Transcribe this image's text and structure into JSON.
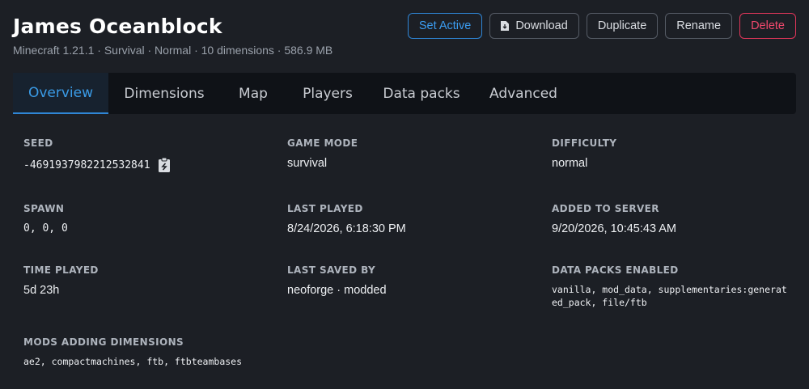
{
  "world": {
    "title": "James Oceanblock",
    "subtitle": "Minecraft 1.21.1 · Survival · Normal · 10 dimensions · 586.9 MB"
  },
  "actions": {
    "set_active": "Set Active",
    "download": "Download",
    "duplicate": "Duplicate",
    "rename": "Rename",
    "delete": "Delete"
  },
  "tabs": [
    "Overview",
    "Dimensions",
    "Map",
    "Players",
    "Data packs",
    "Advanced"
  ],
  "active_tab": "Overview",
  "overview": {
    "seed": {
      "label": "SEED",
      "value": "-4691937982212532841"
    },
    "game_mode": {
      "label": "GAME MODE",
      "value": "survival"
    },
    "difficulty": {
      "label": "DIFFICULTY",
      "value": "normal"
    },
    "spawn": {
      "label": "SPAWN",
      "value": "0, 0, 0"
    },
    "last_played": {
      "label": "LAST PLAYED",
      "value": "8/24/2026, 6:18:30 PM"
    },
    "added_to_server": {
      "label": "ADDED TO SERVER",
      "value": "9/20/2026, 10:45:43 AM"
    },
    "time_played": {
      "label": "TIME PLAYED",
      "value": "5d 23h"
    },
    "last_saved_by": {
      "label": "LAST SAVED BY",
      "value": "neoforge · modded"
    },
    "data_packs_enabled": {
      "label": "DATA PACKS ENABLED",
      "value": "vanilla, mod_data, supplementaries:generated_pack, file/ftb"
    },
    "mods_adding_dimensions": {
      "label": "MODS ADDING DIMENSIONS",
      "value": "ae2, compactmachines, ftb, ftbteambases"
    }
  },
  "colors": {
    "background": "#1c1f25",
    "tab_bar": "#0f1217",
    "accent": "#2f86d6",
    "danger": "#e0365a"
  },
  "icons": {
    "download": "file-download-icon",
    "copy": "clipboard-copy-icon"
  }
}
